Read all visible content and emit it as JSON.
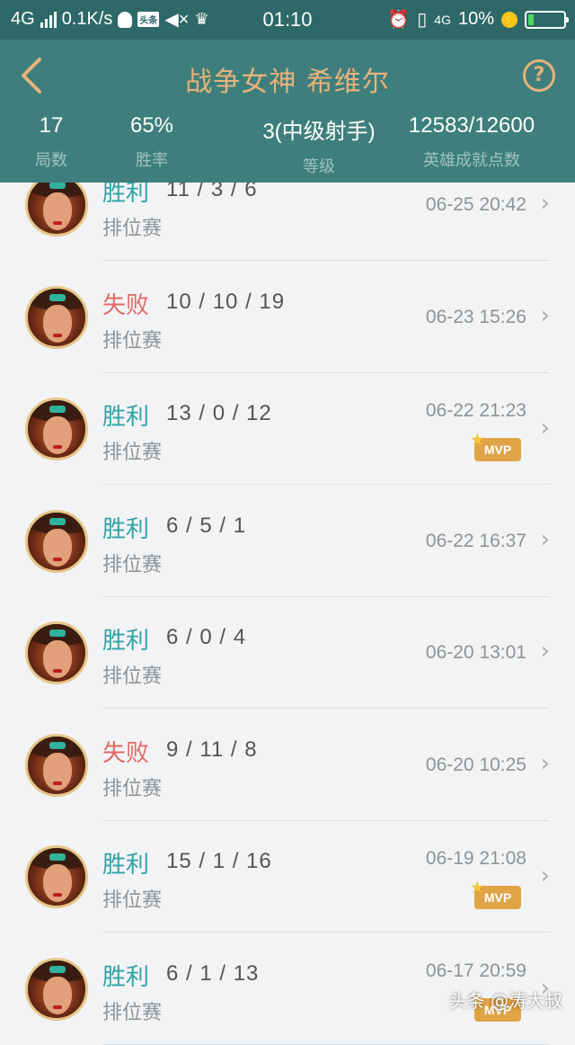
{
  "status_bar": {
    "network": "4G",
    "speed": "0.1K/s",
    "time": "01:10",
    "network_right": "4G",
    "battery": "10%",
    "toutiao_badge": "头条"
  },
  "header": {
    "title": "战争女神 希维尔",
    "help": "?",
    "stats": [
      {
        "value": "17",
        "label": "局数"
      },
      {
        "value": "65%",
        "label": "胜率"
      },
      {
        "value": "3(中级射手)",
        "label": "等级"
      },
      {
        "value": "12583/12600",
        "label": "英雄成就点数"
      }
    ]
  },
  "matches": [
    {
      "result": "胜利",
      "kda": "11 / 3 / 6",
      "mode": "排位赛",
      "time": "06-25 20:42",
      "mvp": false
    },
    {
      "result": "失败",
      "kda": "10 / 10 / 19",
      "mode": "排位赛",
      "time": "06-23 15:26",
      "mvp": false
    },
    {
      "result": "胜利",
      "kda": "13 / 0 / 12",
      "mode": "排位赛",
      "time": "06-22 21:23",
      "mvp": true
    },
    {
      "result": "胜利",
      "kda": "6 / 5 / 1",
      "mode": "排位赛",
      "time": "06-22 16:37",
      "mvp": false
    },
    {
      "result": "胜利",
      "kda": "6 / 0 / 4",
      "mode": "排位赛",
      "time": "06-20 13:01",
      "mvp": false
    },
    {
      "result": "失败",
      "kda": "9 / 11 / 8",
      "mode": "排位赛",
      "time": "06-20 10:25",
      "mvp": false
    },
    {
      "result": "胜利",
      "kda": "15 / 1 / 16",
      "mode": "排位赛",
      "time": "06-19 21:08",
      "mvp": true
    },
    {
      "result": "胜利",
      "kda": "6 / 1 / 13",
      "mode": "排位赛",
      "time": "06-17 20:59",
      "mvp": true
    }
  ],
  "mvp_label": "MVP",
  "chevron": "›",
  "watermark": "头条 @涛大叔",
  "colors": {
    "header_bg": "#3e7f7d",
    "title": "#e8b27a",
    "win": "#2fa3a8",
    "lose": "#e06a68",
    "mvp": "#e0a345"
  }
}
